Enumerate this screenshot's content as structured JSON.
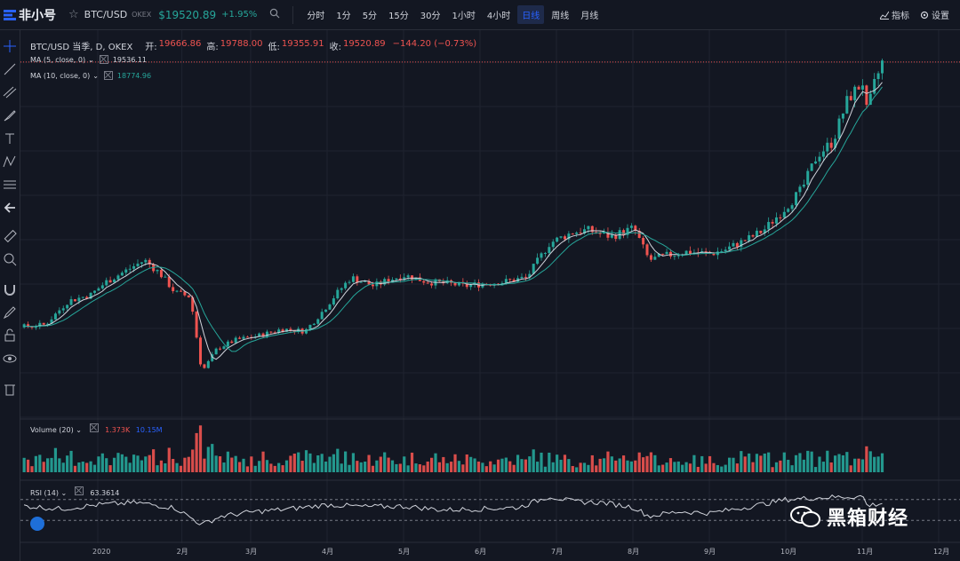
{
  "topbar": {
    "logo_text": "非小号",
    "symbol": "BTC/USD",
    "exchange": "OKEX",
    "price": "$19520.89",
    "change": "+1.95%",
    "intervals": [
      "分时",
      "1分",
      "5分",
      "15分",
      "30分",
      "1小时",
      "4小时",
      "日线",
      "周线",
      "月线"
    ],
    "active_interval": "日线",
    "indicators_label": "指标",
    "settings_label": "设置"
  },
  "legend": {
    "title": "BTC/USD 当季, D, OKEX",
    "open_label": "开:",
    "open": "19666.86",
    "high_label": "高:",
    "high": "19788.00",
    "low_label": "低:",
    "low": "19355.91",
    "close_label": "收:",
    "close": "19520.89",
    "change": "−144.20 (−0.73%)"
  },
  "ma5": {
    "label": "MA (5, close, 0)",
    "value": "19536.11"
  },
  "ma10": {
    "label": "MA (10, close, 0)",
    "value": "18774.96"
  },
  "volume": {
    "label": "Volume (20)",
    "v1": "1.373K",
    "v2": "10.15M"
  },
  "rsi": {
    "label": "RSI (14)",
    "value": "63.3614"
  },
  "watermark": "黑箱财经",
  "colors": {
    "up": "#26a69a",
    "down": "#ef5350",
    "ma5": "#d1d4dc",
    "ma10": "#26a69a",
    "bg": "#131722",
    "grid": "#1f2330"
  },
  "chart_data": {
    "type": "candlestick",
    "x_ticks": [
      "2020",
      "2月",
      "3月",
      "4月",
      "5月",
      "6月",
      "7月",
      "8月",
      "9月",
      "10月",
      "11月",
      "12月"
    ],
    "x_tick_positions": [
      0.0,
      1.1,
      2.0,
      3.0,
      4.0,
      5.0,
      6.0,
      7.0,
      8.0,
      9.0,
      10.0,
      11.0
    ],
    "close_path": [
      [
        0,
        7200
      ],
      [
        0.3,
        7300
      ],
      [
        0.6,
        8400
      ],
      [
        0.9,
        8700
      ],
      [
        1.1,
        9300
      ],
      [
        1.4,
        9900
      ],
      [
        1.6,
        10300
      ],
      [
        1.8,
        9700
      ],
      [
        2.0,
        8800
      ],
      [
        2.2,
        8600
      ],
      [
        2.35,
        5100
      ],
      [
        2.55,
        6200
      ],
      [
        2.8,
        6600
      ],
      [
        3.1,
        6800
      ],
      [
        3.4,
        7100
      ],
      [
        3.7,
        7000
      ],
      [
        3.9,
        7800
      ],
      [
        4.1,
        8700
      ],
      [
        4.3,
        9500
      ],
      [
        4.6,
        9100
      ],
      [
        4.8,
        9400
      ],
      [
        5.0,
        9600
      ],
      [
        5.3,
        9300
      ],
      [
        5.6,
        9200
      ],
      [
        5.8,
        9100
      ],
      [
        6.0,
        9200
      ],
      [
        6.3,
        9300
      ],
      [
        6.6,
        9500
      ],
      [
        6.9,
        11100
      ],
      [
        7.2,
        11600
      ],
      [
        7.4,
        11700
      ],
      [
        7.7,
        11400
      ],
      [
        8.0,
        11800
      ],
      [
        8.2,
        10300
      ],
      [
        8.4,
        10500
      ],
      [
        8.7,
        10700
      ],
      [
        9.0,
        10600
      ],
      [
        9.2,
        10800
      ],
      [
        9.5,
        11300
      ],
      [
        9.7,
        11700
      ],
      [
        10.0,
        12800
      ],
      [
        10.2,
        13600
      ],
      [
        10.4,
        15200
      ],
      [
        10.6,
        15800
      ],
      [
        10.8,
        17800
      ],
      [
        11.0,
        18600
      ],
      [
        11.05,
        17100
      ],
      [
        11.15,
        18500
      ],
      [
        11.25,
        19500
      ]
    ],
    "rsi_path": [
      [
        0,
        58
      ],
      [
        0.5,
        52
      ],
      [
        1.0,
        60
      ],
      [
        1.5,
        64
      ],
      [
        2.0,
        54
      ],
      [
        2.35,
        22
      ],
      [
        2.6,
        38
      ],
      [
        3.0,
        46
      ],
      [
        3.5,
        52
      ],
      [
        4.0,
        60
      ],
      [
        4.5,
        56
      ],
      [
        5.0,
        57
      ],
      [
        5.5,
        50
      ],
      [
        6.0,
        52
      ],
      [
        6.5,
        55
      ],
      [
        6.9,
        76
      ],
      [
        7.2,
        66
      ],
      [
        7.6,
        64
      ],
      [
        8.0,
        55
      ],
      [
        8.2,
        38
      ],
      [
        8.6,
        47
      ],
      [
        9.0,
        44
      ],
      [
        9.5,
        56
      ],
      [
        10.0,
        70
      ],
      [
        10.5,
        74
      ],
      [
        11.0,
        76
      ],
      [
        11.05,
        58
      ],
      [
        11.25,
        63
      ]
    ],
    "rsi_bands": [
      30,
      70
    ]
  }
}
